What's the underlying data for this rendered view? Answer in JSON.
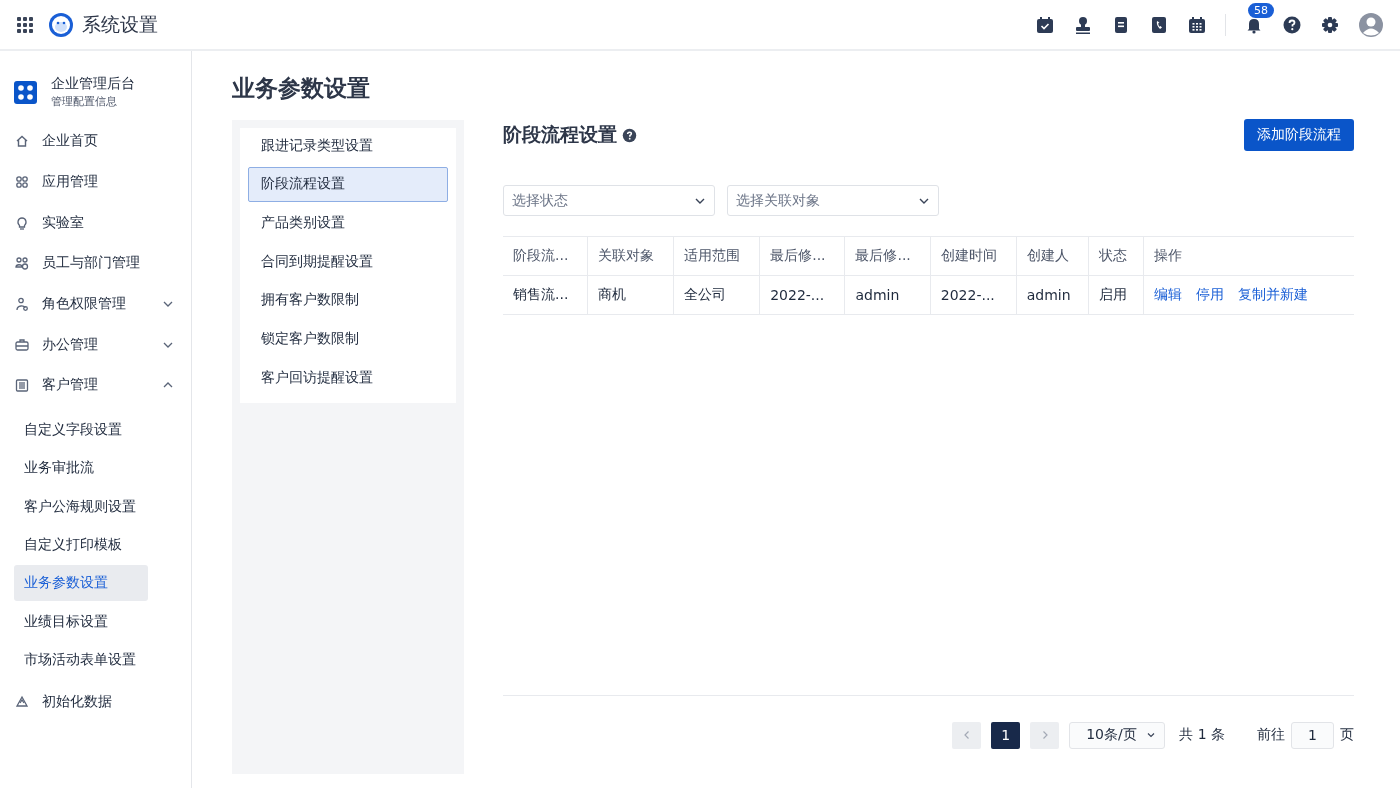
{
  "topbar": {
    "title": "系统设置",
    "notification_count": "58"
  },
  "sidebar": {
    "org_title": "企业管理后台",
    "org_subtitle": "管理配置信息",
    "items": [
      {
        "label": "企业首页"
      },
      {
        "label": "应用管理"
      },
      {
        "label": "实验室"
      },
      {
        "label": "员工与部门管理"
      },
      {
        "label": "角色权限管理",
        "expanded": false
      },
      {
        "label": "办公管理",
        "expanded": false
      },
      {
        "label": "客户管理",
        "expanded": true,
        "children": [
          {
            "label": "自定义字段设置",
            "selected": false
          },
          {
            "label": "业务审批流",
            "selected": false
          },
          {
            "label": "客户公海规则设置",
            "selected": false
          },
          {
            "label": "自定义打印模板",
            "selected": false
          },
          {
            "label": "业务参数设置",
            "selected": true
          },
          {
            "label": "业绩目标设置",
            "selected": false
          },
          {
            "label": "市场活动表单设置",
            "selected": false
          }
        ]
      },
      {
        "label": "初始化数据"
      }
    ]
  },
  "page_title": "业务参数设置",
  "settings_menu": [
    {
      "label": "跟进记录类型设置",
      "selected": false
    },
    {
      "label": "阶段流程设置",
      "selected": true
    },
    {
      "label": "产品类别设置",
      "selected": false
    },
    {
      "label": "合同到期提醒设置",
      "selected": false
    },
    {
      "label": "拥有客户数限制",
      "selected": false
    },
    {
      "label": "锁定客户数限制",
      "selected": false
    },
    {
      "label": "客户回访提醒设置",
      "selected": false
    }
  ],
  "section": {
    "title": "阶段流程设置",
    "add_button": "添加阶段流程"
  },
  "filters": [
    {
      "placeholder": "选择状态"
    },
    {
      "placeholder": "选择关联对象"
    }
  ],
  "table": {
    "columns": [
      "阶段流...",
      "关联对象",
      "适用范围",
      "最后修...",
      "最后修...",
      "创建时间",
      "创建人",
      "状态",
      "操作"
    ],
    "rows": [
      {
        "cells": [
          "销售流...",
          "商机",
          "全公司",
          "2022-...",
          "admin",
          "2022-...",
          "admin",
          "启用"
        ],
        "actions": [
          "编辑",
          "停用",
          "复制并新建"
        ]
      }
    ]
  },
  "pagination": {
    "pages": [
      {
        "label": "1",
        "selected": true
      }
    ],
    "page_size": "10条/页",
    "total": "共 1 条",
    "goto_label": "前往",
    "goto_value": "1",
    "page_suffix": "页"
  }
}
